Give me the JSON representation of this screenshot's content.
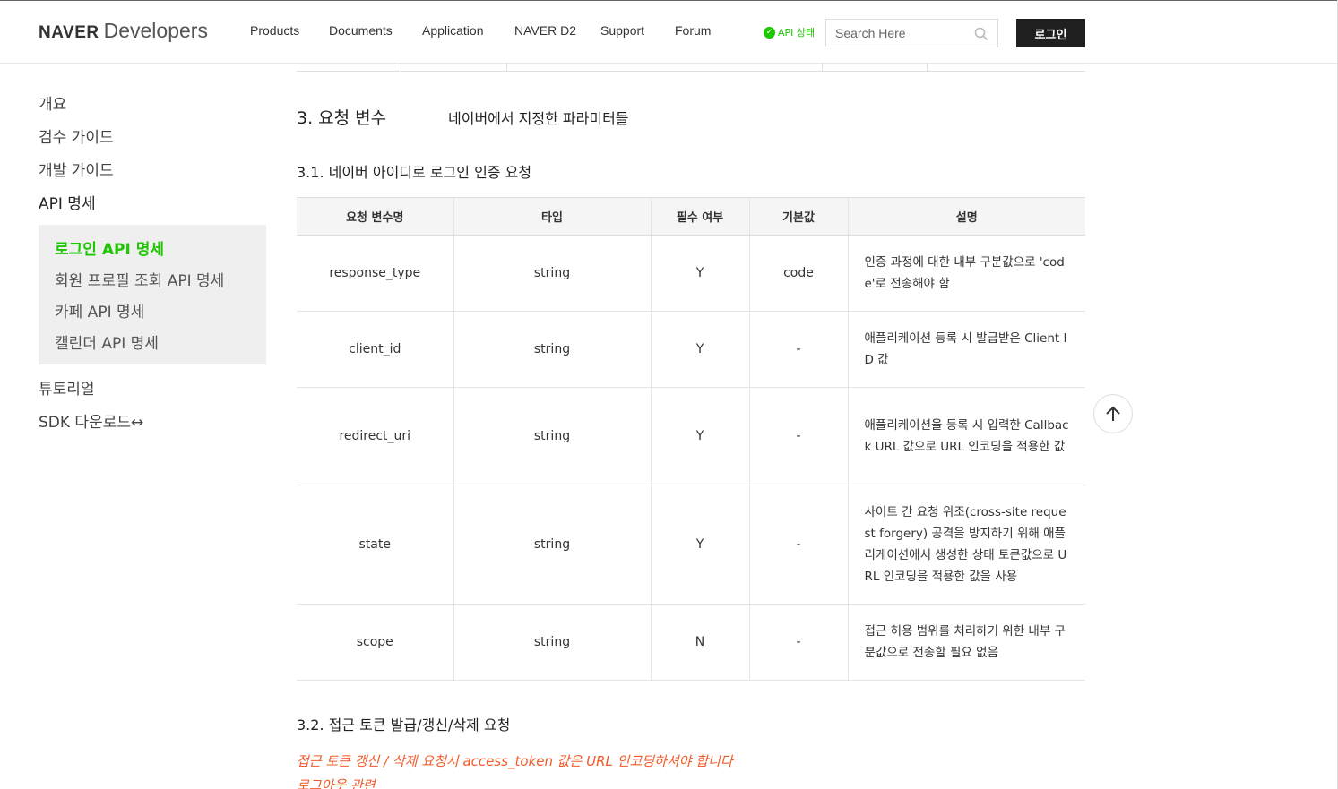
{
  "header": {
    "logo_brand": "NAVER",
    "logo_product": "Developers",
    "nav": [
      "Products",
      "Documents",
      "Application",
      "NAVER D2",
      "Support",
      "Forum"
    ],
    "api_status": "API 상태",
    "search_placeholder": "Search Here",
    "login_label": "로그인"
  },
  "sidebar": {
    "items_top": [
      "개요",
      "검수 가이드",
      "개발 가이드",
      "API 명세"
    ],
    "submenu": [
      "로그인 API 명세",
      "회원 프로필 조회 API 명세",
      "카페 API 명세",
      "캘린더 API 명세"
    ],
    "items_bottom": [
      "튜토리얼",
      "SDK 다운로드↔"
    ]
  },
  "main": {
    "section_title": "3. 요청 변수",
    "section_desc": "네이버에서 지정한 파라미터들",
    "subsection_1": "3.1. 네이버 아이디로 로그인 인증 요청",
    "table": {
      "headers": [
        "요청 변수명",
        "타입",
        "필수 여부",
        "기본값",
        "설명"
      ],
      "rows": [
        [
          "response_type",
          "string",
          "Y",
          "code",
          "인증 과정에 대한 내부 구분값으로 'code'로 전송해야 함"
        ],
        [
          "client_id",
          "string",
          "Y",
          "-",
          "애플리케이션 등록 시 발급받은 Client ID 값"
        ],
        [
          "redirect_uri",
          "string",
          "Y",
          "-",
          "애플리케이션을 등록 시 입력한 Callback URL 값으로 URL 인코딩을 적용한 값"
        ],
        [
          "state",
          "string",
          "Y",
          "-",
          "사이트 간 요청 위조(cross-site request forgery) 공격을 방지하기 위해 애플리케이션에서 생성한 상태 토큰값으로 URL 인코딩을 적용한 값을 사용"
        ],
        [
          "scope",
          "string",
          "N",
          "-",
          "접근 허용 범위를 처리하기 위한 내부 구분값으로 전송할 필요 없음"
        ]
      ]
    },
    "subsection_2": "3.2. 접근 토큰 발급/갱신/삭제 요청",
    "note": "접근 토큰 갱신 / 삭제 요청시 access_token 값은 URL 인코딩하셔야 합니다",
    "note_cut": "로그아웃 관련"
  },
  "colors": {
    "accent_green": "#1ec800",
    "note_orange": "#f05b2b",
    "login_bg": "#1f1f1f"
  }
}
